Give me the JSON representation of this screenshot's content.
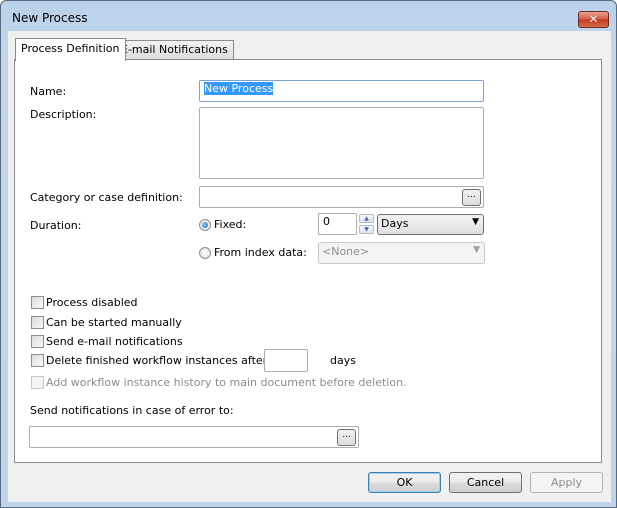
{
  "window": {
    "title": "New Process",
    "close_icon": "close-icon"
  },
  "tabs": [
    {
      "label": "Process Definition",
      "active": true
    },
    {
      "label": "E-mail Notifications",
      "active": false
    }
  ],
  "form": {
    "name_label": "Name:",
    "name_value": "New Process",
    "description_label": "Description:",
    "description_value": "",
    "category_label": "Category or case definition:",
    "category_value": "",
    "browse_label": "...",
    "duration_label": "Duration:",
    "fixed_label": "Fixed:",
    "fixed_selected": true,
    "fixed_value": "0",
    "unit_value": "Days",
    "from_index_label": "From index data:",
    "from_index_selected": false,
    "index_value": "<None>"
  },
  "options": {
    "process_disabled": {
      "label": "Process disabled",
      "checked": false
    },
    "started_manually": {
      "label": "Can be started manually",
      "checked": false
    },
    "send_email": {
      "label": "Send e-mail notifications",
      "checked": false
    },
    "delete_finished": {
      "label": "Delete finished workflow instances after",
      "checked": false,
      "value": ""
    },
    "days_label": "days",
    "add_history": {
      "label": "Add workflow instance history to main document before deletion.",
      "checked": false,
      "enabled": false
    }
  },
  "notify": {
    "label": "Send notifications in case of error to:",
    "value": "",
    "browse_label": "..."
  },
  "buttons": {
    "ok": "OK",
    "cancel": "Cancel",
    "apply": "Apply"
  }
}
